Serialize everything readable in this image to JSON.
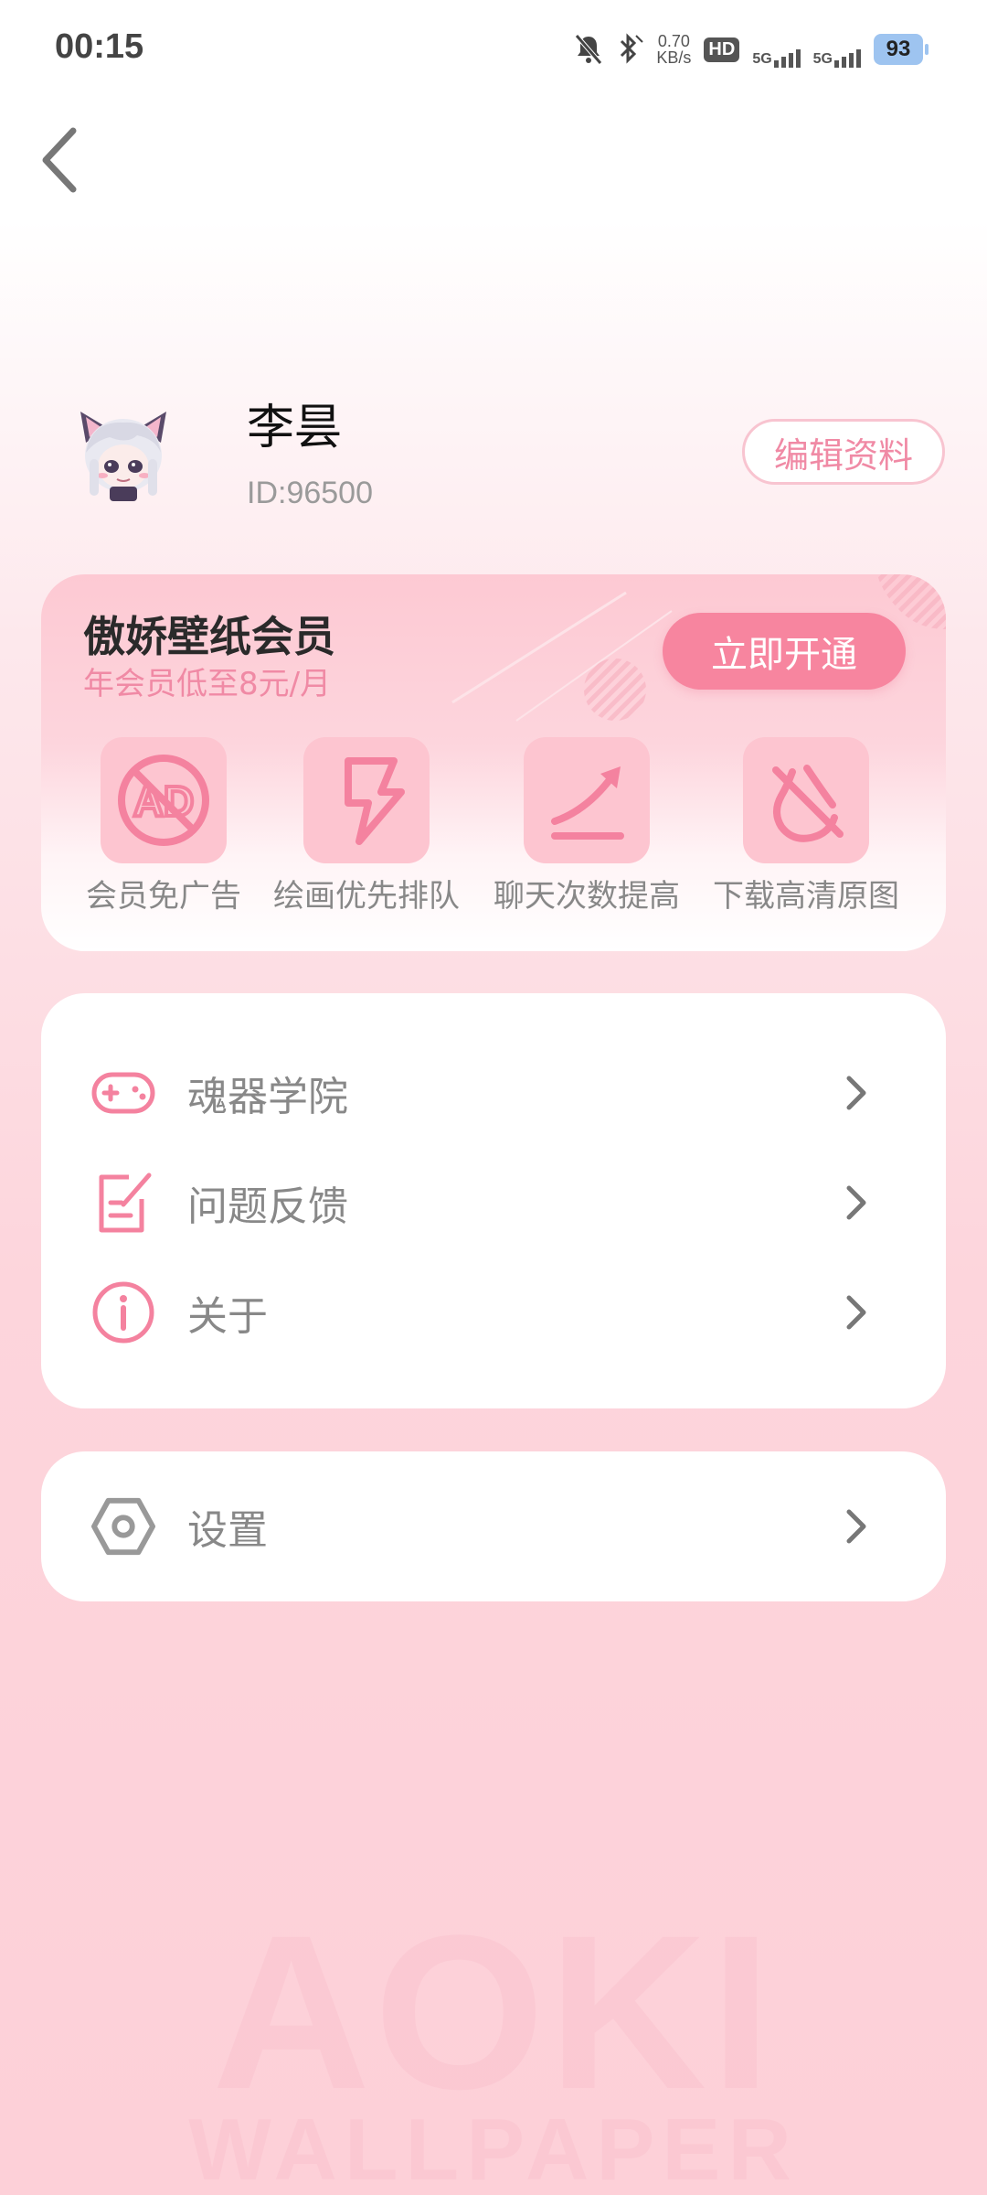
{
  "status_bar": {
    "time": "00:15",
    "net_speed_value": "0.70",
    "net_speed_unit": "KB/s",
    "hd_label": "HD",
    "sim1_label": "5G",
    "sim2_label": "5G",
    "battery": "93"
  },
  "profile": {
    "name": "李昙",
    "id": "ID:96500",
    "edit_label": "编辑资料"
  },
  "vip": {
    "title": "傲娇壁纸会员",
    "subtitle": "年会员低至8元/月",
    "open_label": "立即开通",
    "benefits": [
      {
        "label": "会员免广告",
        "icon": "no-ads-icon"
      },
      {
        "label": "绘画优先排队",
        "icon": "lightning-icon"
      },
      {
        "label": "聊天次数提高",
        "icon": "trend-up-icon"
      },
      {
        "label": "下载高清原图",
        "icon": "no-watermark-icon"
      }
    ]
  },
  "menu": {
    "items": [
      {
        "label": "魂器学院",
        "icon": "gamepad-icon"
      },
      {
        "label": "问题反馈",
        "icon": "feedback-edit-icon"
      },
      {
        "label": "关于",
        "icon": "info-icon"
      }
    ]
  },
  "settings": {
    "label": "设置",
    "icon": "settings-hexagon-icon"
  },
  "watermark": {
    "big": "AOKI",
    "small": "WALLPAPER"
  },
  "colors": {
    "accent": "#f7859f",
    "accent_light": "#fdc5d0",
    "text_muted": "#888888"
  }
}
